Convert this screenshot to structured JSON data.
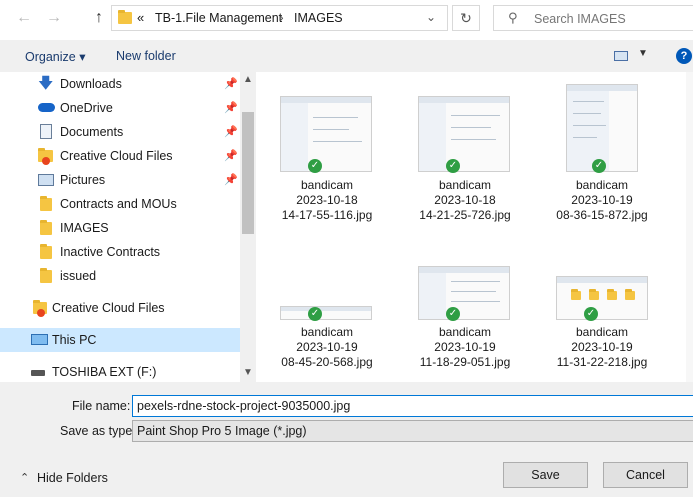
{
  "address": {
    "crumbs": [
      "«",
      "TB-1.File Management",
      "›",
      "IMAGES"
    ],
    "search_placeholder": "Search IMAGES"
  },
  "toolbar": {
    "organize_label": "Organize ▾",
    "new_folder_label": "New folder"
  },
  "nav": [
    {
      "label": "Downloads",
      "icon": "download-icon",
      "pinned": true
    },
    {
      "label": "OneDrive",
      "icon": "cloud-icon",
      "pinned": true
    },
    {
      "label": "Documents",
      "icon": "document-icon",
      "pinned": true
    },
    {
      "label": "Creative Cloud Files",
      "icon": "creative-cloud-icon",
      "pinned": true
    },
    {
      "label": "Pictures",
      "icon": "pictures-icon",
      "pinned": true
    },
    {
      "label": "Contracts and MOUs",
      "icon": "folder-icon",
      "pinned": false
    },
    {
      "label": "IMAGES",
      "icon": "folder-icon",
      "pinned": false
    },
    {
      "label": "Inactive Contracts",
      "icon": "folder-icon",
      "pinned": false
    },
    {
      "label": "issued",
      "icon": "folder-icon",
      "pinned": false
    },
    {
      "label": "Creative Cloud Files",
      "icon": "creative-cloud-icon",
      "pinned": false
    },
    {
      "label": "This PC",
      "icon": "pc-icon",
      "pinned": false,
      "selected": true
    },
    {
      "label": "TOSHIBA EXT (F:)",
      "icon": "drive-icon",
      "pinned": false
    }
  ],
  "files": [
    {
      "line1": "bandicam",
      "line2": "2023-10-18",
      "line3": "14-17-55-116.jpg"
    },
    {
      "line1": "bandicam",
      "line2": "2023-10-18",
      "line3": "14-21-25-726.jpg"
    },
    {
      "line1": "bandicam",
      "line2": "2023-10-19",
      "line3": "08-36-15-872.jpg"
    },
    {
      "line1": "bandicam",
      "line2": "2023-10-19",
      "line3": "08-45-20-568.jpg"
    },
    {
      "line1": "bandicam",
      "line2": "2023-10-19",
      "line3": "11-18-29-051.jpg"
    },
    {
      "line1": "bandicam",
      "line2": "2023-10-19",
      "line3": "11-31-22-218.jpg"
    }
  ],
  "form": {
    "file_name_label": "File name:",
    "file_name_value": "pexels-rdne-stock-project-9035000.jpg",
    "save_type_label": "Save as type:",
    "save_type_value": "Paint Shop Pro 5 Image (*.jpg)"
  },
  "buttons": {
    "hide_folders": "Hide Folders",
    "save": "Save",
    "cancel": "Cancel"
  },
  "colors": {
    "accent": "#0078d7",
    "selected_bg": "#cce8ff",
    "check": "#2f9e44"
  }
}
